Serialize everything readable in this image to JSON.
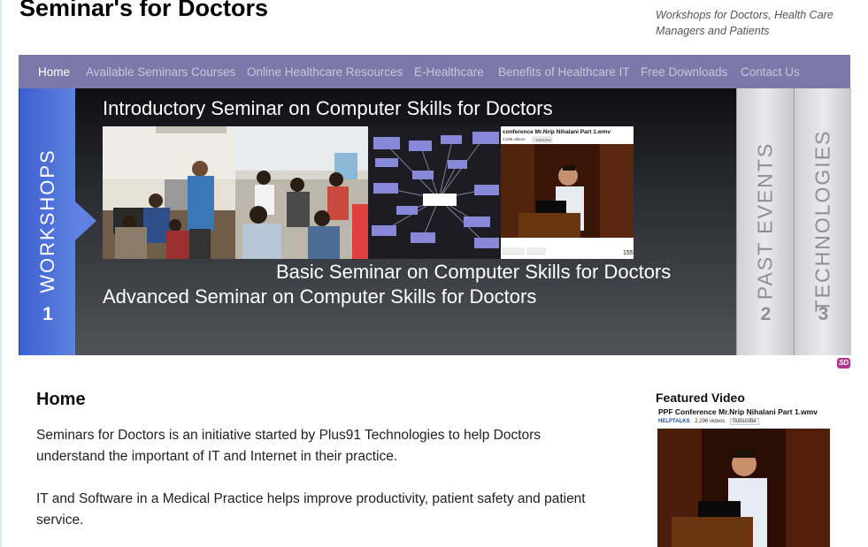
{
  "site": {
    "title": "Seminar's for Doctors",
    "tagline": "Workshops for Doctors, Health Care Managers and Patients"
  },
  "nav": {
    "items": [
      {
        "label": "Home",
        "active": true
      },
      {
        "label": "Available Seminars Courses"
      },
      {
        "label": "Online Healthcare Resources"
      },
      {
        "label": "E-Healthcare"
      },
      {
        "label": "Benefits of Healthcare IT"
      },
      {
        "label": "Free Downloads"
      },
      {
        "label": "Contact Us"
      }
    ]
  },
  "slider": {
    "tabs": [
      {
        "label": "WORKSHOPS",
        "number": "1"
      },
      {
        "label": "PAST EVENTS",
        "number": "2"
      },
      {
        "label": "TECHNOLOGIES",
        "number": "3"
      }
    ],
    "slides": [
      "Introductory Seminar on Computer Skills for Doctors",
      "Basic Seminar on Computer Skills for Doctors",
      "Advanced Seminar on Computer Skills for Doctors"
    ],
    "video_thumb": {
      "title": "conference Mr.Nrip Nihalani Part 1.wmv",
      "views": "2,296 videos",
      "subscribe": "Subscribe",
      "count": "155"
    },
    "badge": "SD"
  },
  "content": {
    "heading": "Home",
    "paragraphs": [
      "Seminars for Doctors is an initiative started by Plus91 Technologies to help Doctors understand the important of IT and Internet in their practice.",
      "IT and Software in a Medical Practice helps improve productivity, patient safety and patient service."
    ]
  },
  "featured": {
    "title": "Featured Video",
    "video_title": "PPF Conference Mr.Nrip Nihalani Part 1.wmv",
    "channel": "HELPTALKS",
    "views": "2,296 videos",
    "subscribe": "Subscribe"
  },
  "colors": {
    "nav_bg": "#7c78a9",
    "active_tab": "#4a6ed8",
    "badge": "#b0378e"
  }
}
